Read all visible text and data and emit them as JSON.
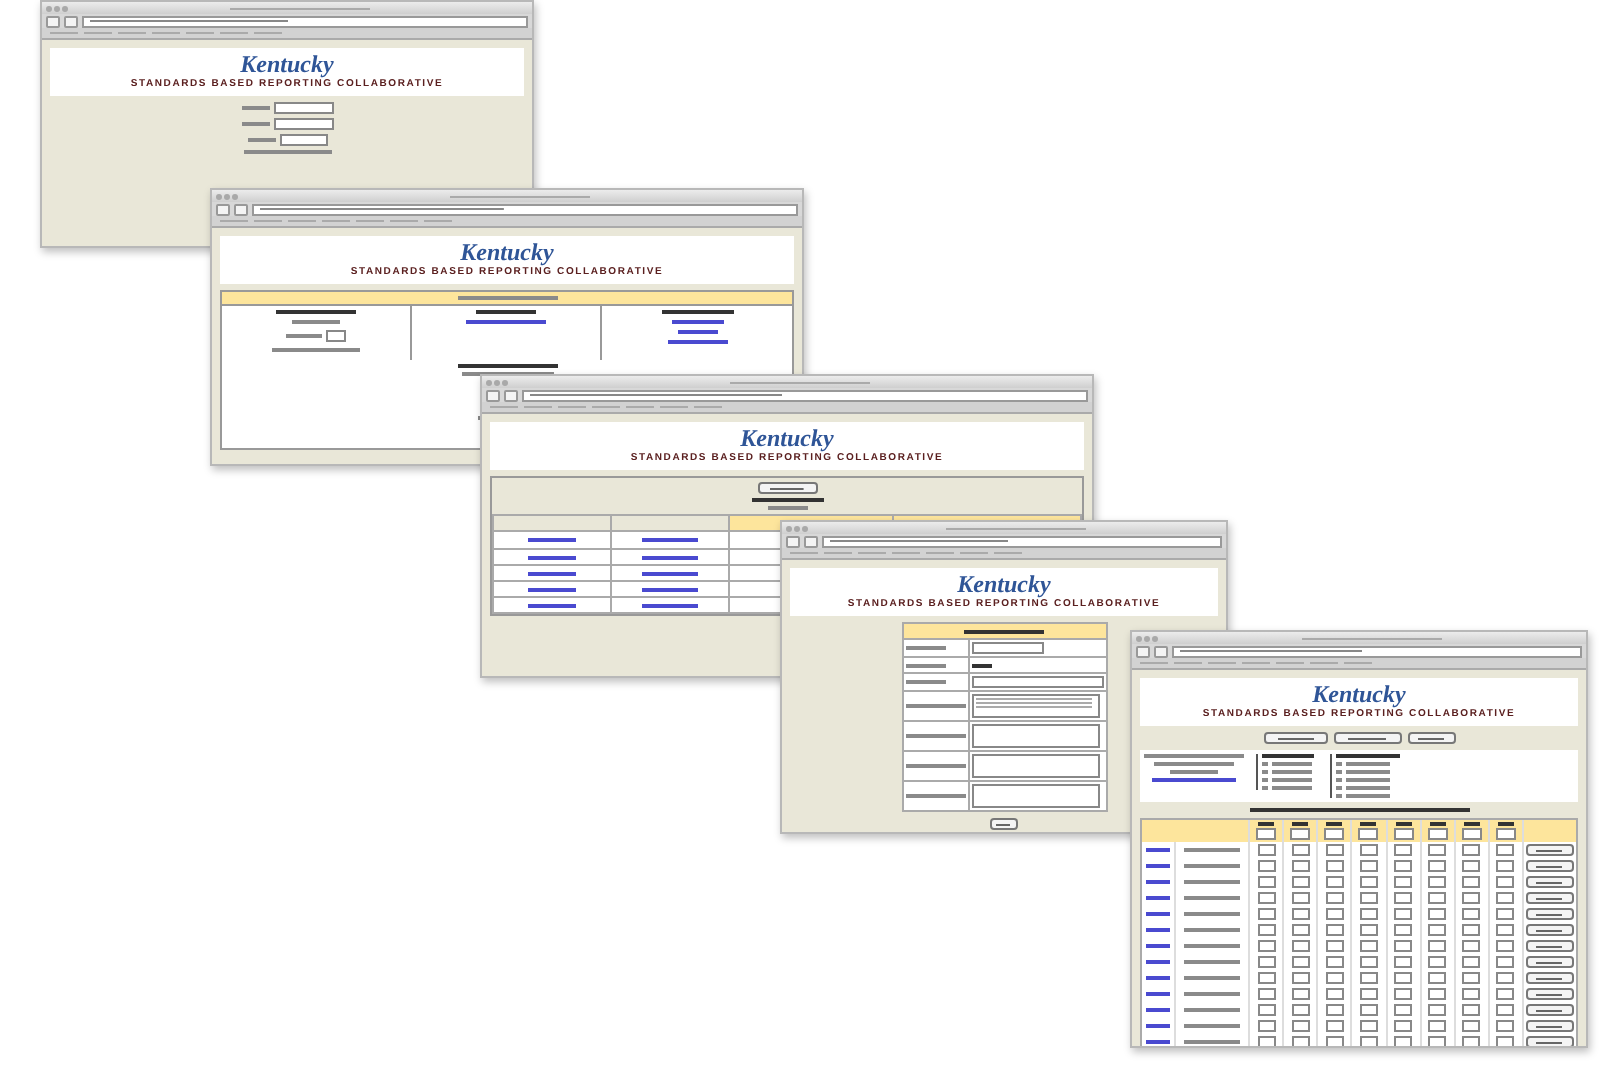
{
  "windows": [
    {
      "kind": "login",
      "logo": "Kentucky",
      "heading": "STANDARDS BASED REPORTING COLLABORATIVE"
    },
    {
      "kind": "menu",
      "logo": "Kentucky",
      "heading": "STANDARDS BASED REPORTING COLLABORATIVE"
    },
    {
      "kind": "sections",
      "logo": "Kentucky",
      "heading": "STANDARDS BASED REPORTING COLLABORATIVE"
    },
    {
      "kind": "course",
      "logo": "Kentucky",
      "heading": "STANDARDS BASED REPORTING COLLABORATIVE"
    },
    {
      "kind": "scores",
      "logo": "Kentucky",
      "heading": "STANDARDS BASED REPORTING COLLABORATIVE"
    }
  ]
}
